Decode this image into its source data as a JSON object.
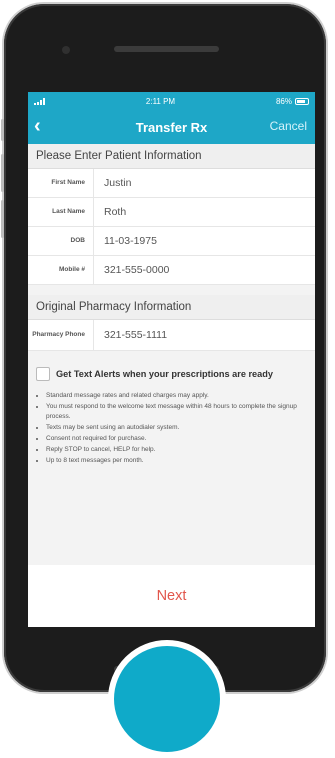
{
  "status_bar": {
    "time": "2:11 PM",
    "battery": "86%"
  },
  "nav": {
    "title": "Transfer Rx",
    "cancel": "Cancel"
  },
  "patient": {
    "header": "Please Enter Patient Information",
    "fields": [
      {
        "label": "First Name",
        "value": "Justin"
      },
      {
        "label": "Last Name",
        "value": "Roth"
      },
      {
        "label": "DOB",
        "value": "11-03-1975"
      },
      {
        "label": "Mobile #",
        "value": "321-555-0000"
      }
    ]
  },
  "pharmacy": {
    "header": "Original Pharmacy Information",
    "fields": [
      {
        "label": "Pharmacy Phone",
        "value": "321-555-1111"
      }
    ]
  },
  "alerts": {
    "label": "Get Text Alerts when your prescriptions are ready",
    "checked": false,
    "bullets": [
      "Standard message rates and related charges may apply.",
      "You must respond to the welcome text message within 48 hours to complete the signup process.",
      "Texts may be sent using an autodialer system.",
      "Consent not required for purchase.",
      "Reply STOP to cancel, HELP for help.",
      "Up to 8 text messages per month."
    ]
  },
  "footer": {
    "next": "Next"
  },
  "colors": {
    "accent": "#1ea7c7",
    "next": "#e2564c"
  },
  "icons": {
    "back": "chevron-left-icon"
  }
}
